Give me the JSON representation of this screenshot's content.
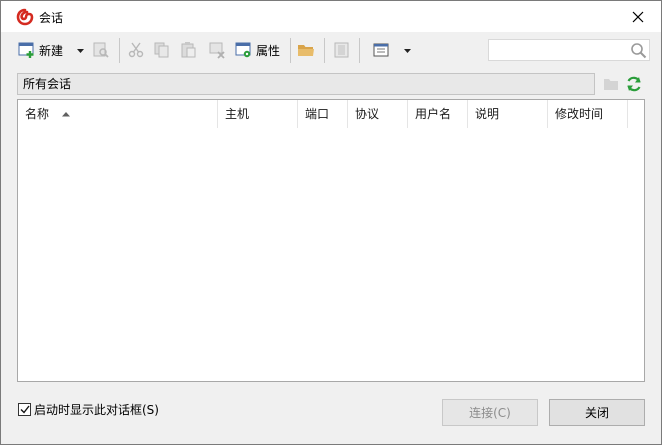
{
  "window": {
    "title": "会话",
    "app_icon": "swirl-logo-icon",
    "close_icon": "close-icon"
  },
  "toolbar": {
    "new_label": "新建",
    "properties_label": "属性",
    "icons": [
      "new-session-icon",
      "dropdown-arrow-icon",
      "find-icon",
      "cut-icon",
      "copy-icon",
      "paste-icon",
      "delete-icon",
      "properties-icon",
      "open-folder-icon",
      "export-icon",
      "view-icon",
      "view-dropdown-icon"
    ]
  },
  "search": {
    "placeholder": "",
    "value": ""
  },
  "path": {
    "current": "所有会话",
    "icons": [
      "new-folder-icon",
      "refresh-icon"
    ]
  },
  "list": {
    "columns": [
      "名称",
      "主机",
      "端口",
      "协议",
      "用户名",
      "说明",
      "修改时间"
    ],
    "sort_column": "名称",
    "sort_direction": "ascending",
    "rows": []
  },
  "footer": {
    "startup_checkbox_label": "启动时显示此对话框(S)",
    "startup_checked": true,
    "connect_label": "连接(C)",
    "connect_enabled": false,
    "close_label": "关闭"
  },
  "colors": {
    "accent_red": "#d42a20",
    "refresh_green": "#2a9d3a",
    "folder_orange": "#e0a040"
  }
}
